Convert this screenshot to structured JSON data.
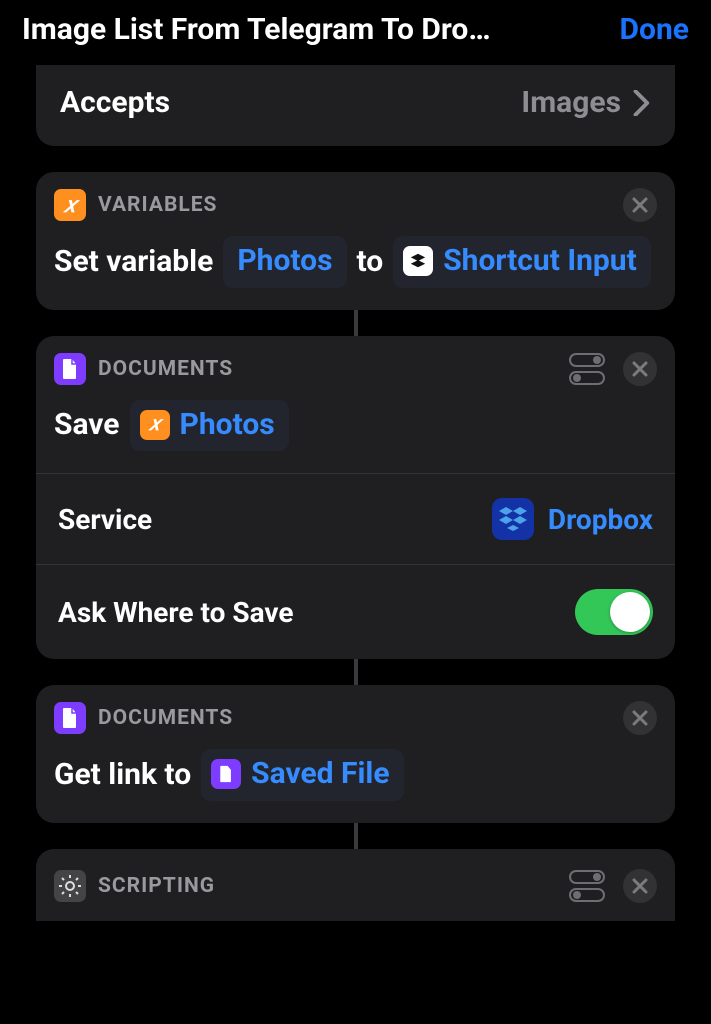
{
  "header": {
    "title": "Image List From Telegram To Dro…",
    "done": "Done"
  },
  "accepts": {
    "label": "Accepts",
    "value": "Images"
  },
  "card_variables": {
    "category": "VARIABLES",
    "text_set_variable": "Set variable",
    "token_photos": "Photos",
    "text_to": "to",
    "token_shortcut_input": "Shortcut Input"
  },
  "card_save": {
    "category": "DOCUMENTS",
    "text_save": "Save",
    "token_photos": "Photos",
    "row_service_label": "Service",
    "row_service_value": "Dropbox",
    "row_ask_label": "Ask Where to Save",
    "ask_where_on": true
  },
  "card_getlink": {
    "category": "DOCUMENTS",
    "text_get_link_to": "Get link to",
    "token_saved_file": "Saved File"
  },
  "card_scripting": {
    "category": "SCRIPTING"
  }
}
